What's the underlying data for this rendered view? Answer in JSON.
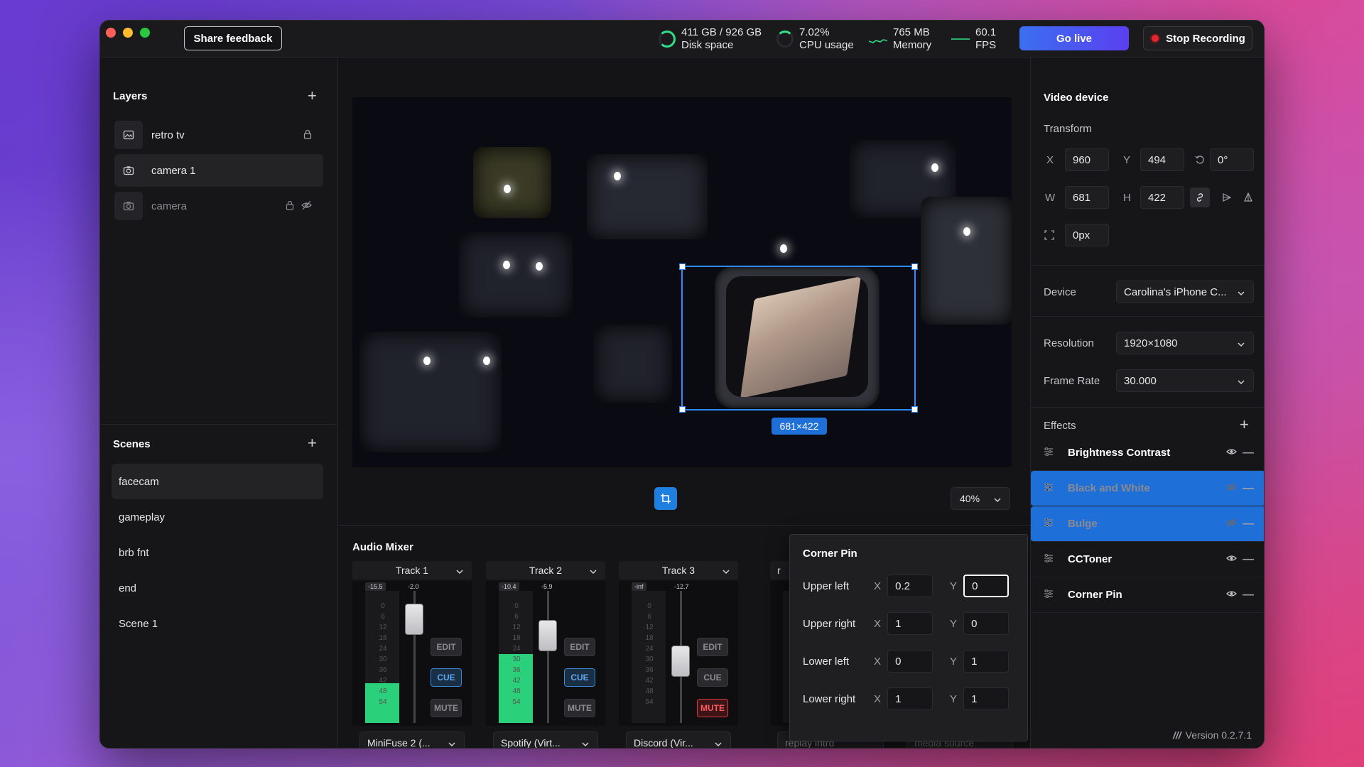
{
  "titlebar": {
    "share_feedback": "Share feedback",
    "disk_value": "411 GB / 926 GB",
    "disk_label": "Disk space",
    "cpu_value": "7.02%",
    "cpu_label": "CPU usage",
    "mem_value": "765 MB",
    "mem_label": "Memory",
    "fps_value": "60.1",
    "fps_label": "FPS",
    "go_live": "Go live",
    "stop_recording": "Stop Recording"
  },
  "layers": {
    "title": "Layers",
    "items": [
      {
        "label": "retro tv"
      },
      {
        "label": "camera 1"
      },
      {
        "label": "camera"
      }
    ]
  },
  "scenes": {
    "title": "Scenes",
    "items": [
      "facecam",
      "gameplay",
      "brb fnt",
      "end",
      "Scene 1"
    ]
  },
  "preview": {
    "selection_size": "681×422",
    "zoom": "40%"
  },
  "mixer": {
    "title": "Audio Mixer",
    "tracks": [
      {
        "name": "Track 1",
        "peak": "-15.5",
        "gain": "-2.0",
        "level_pct": 30,
        "fader_pct": 87,
        "source": "MiniFuse 2 (...",
        "edit": "EDIT",
        "cue": "CUE",
        "mute": "MUTE"
      },
      {
        "name": "Track 2",
        "peak": "-10.4",
        "gain": "-5.9",
        "level_pct": 52,
        "fader_pct": 71,
        "source": "Spotify (Virt...",
        "edit": "EDIT",
        "cue": "CUE",
        "mute": "MUTE"
      },
      {
        "name": "Track 3",
        "peak": "-inf",
        "gain": "-12.7",
        "level_pct": 0,
        "fader_pct": 46,
        "source": "Discord (Vir...",
        "edit": "EDIT",
        "cue": "CUE",
        "mute": "MUTE"
      }
    ],
    "scale": [
      "0",
      "6",
      "12",
      "18",
      "24",
      "30",
      "36",
      "42",
      "48",
      "54"
    ],
    "track4_source": "replay intro",
    "track5_source": "media source"
  },
  "corner_pin": {
    "title": "Corner Pin",
    "rows": [
      {
        "label": "Upper left",
        "x": "0.2",
        "y": "0"
      },
      {
        "label": "Upper right",
        "x": "1",
        "y": "0"
      },
      {
        "label": "Lower left",
        "x": "0",
        "y": "1"
      },
      {
        "label": "Lower right",
        "x": "1",
        "y": "1"
      }
    ],
    "x_label": "X",
    "y_label": "Y"
  },
  "video_device": {
    "title": "Video device",
    "transform_label": "Transform",
    "x_label": "X",
    "x": "960",
    "y_label": "Y",
    "y": "494",
    "rotation": "0°",
    "w_label": "W",
    "w": "681",
    "h_label": "H",
    "h": "422",
    "crop": "0px",
    "device_label": "Device",
    "device": "Carolina's iPhone C...",
    "resolution_label": "Resolution",
    "resolution": "1920×1080",
    "framerate_label": "Frame Rate",
    "framerate": "30.000"
  },
  "effects": {
    "title": "Effects",
    "items": [
      {
        "name": "Brightness Contrast",
        "visible": true
      },
      {
        "name": "Black and White",
        "visible": false
      },
      {
        "name": "Bulge",
        "visible": false
      },
      {
        "name": "CCToner",
        "visible": true
      },
      {
        "name": "Corner Pin",
        "visible": true
      }
    ]
  },
  "version": "Version 0.2.7.1",
  "colors": {
    "accent": "#2f8cff",
    "meter_green": "#2bd07a",
    "record_red": "#e4262e"
  }
}
